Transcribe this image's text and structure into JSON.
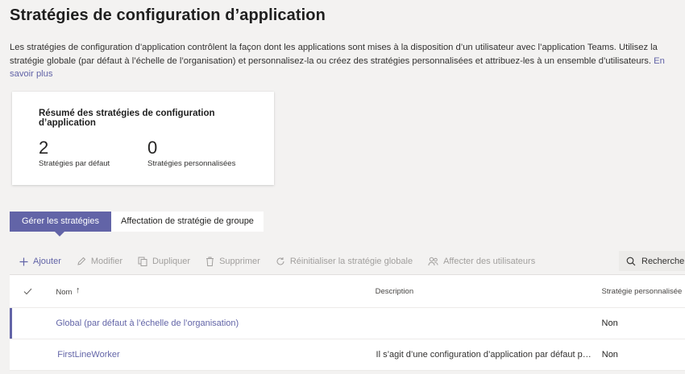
{
  "page": {
    "title": "Stratégies de configuration d’application",
    "intro": "Les stratégies de configuration d’application contrôlent la façon dont les applications sont mises à la disposition d’un utilisateur avec l’application Teams. Utilisez la stratégie globale (par défaut à l’échelle de l’organisation) et personnalisez-la ou créez des stratégies personnalisées et attribuez-les à un ensemble d’utilisateurs.",
    "learn_more": "En savoir plus"
  },
  "summary": {
    "title": "Résumé des stratégies de configuration d’application",
    "default_count": "2",
    "default_label": "Stratégies par défaut",
    "custom_count": "0",
    "custom_label": "Stratégies personnalisées"
  },
  "tabs": [
    {
      "label": "Gérer les stratégies",
      "active": true
    },
    {
      "label": "Affectation de stratégie de groupe",
      "active": false
    }
  ],
  "toolbar": {
    "add": "Ajouter",
    "edit": "Modifier",
    "duplicate": "Dupliquer",
    "delete": "Supprimer",
    "reset": "Réinitialiser la stratégie globale",
    "assign": "Affecter des utilisateurs",
    "search": "Recherche"
  },
  "table": {
    "columns": {
      "name": "Nom",
      "name_sort": "↑",
      "description": "Description",
      "custom": "Stratégie personnalisée"
    },
    "rows": [
      {
        "name": "Global (par défaut à l’échelle de l’organisation)",
        "description": "",
        "custom": "Non"
      },
      {
        "name": "FirstLineWorker",
        "description": "Il s’agit d’une configuration d’application par défaut pour les travailleurs de première ligne",
        "custom": "Non"
      }
    ]
  },
  "colors": {
    "accent": "#6264a7",
    "disabled": "#a19f9d",
    "background": "#f3f2f1"
  }
}
